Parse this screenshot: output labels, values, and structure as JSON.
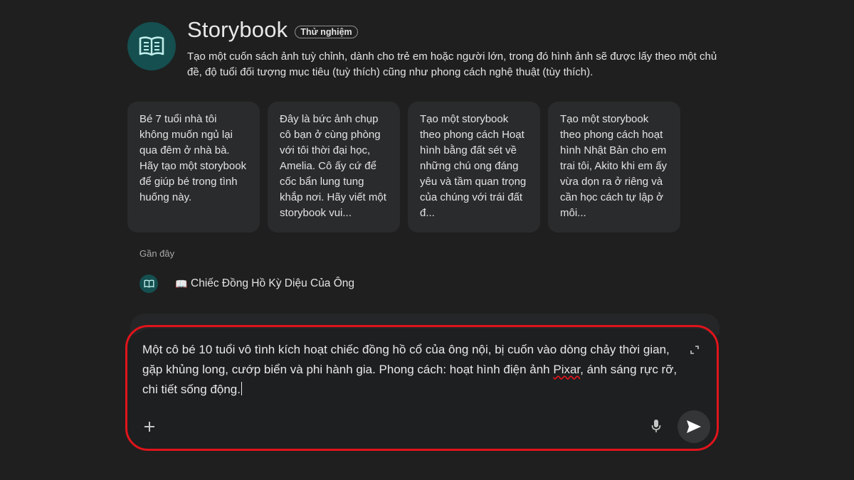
{
  "header": {
    "title": "Storybook",
    "badge": "Thử nghiệm",
    "description": "Tạo một cuốn sách ảnh tuỳ chỉnh, dành cho trẻ em hoặc người lớn, trong đó hình ảnh sẽ được lấy theo một chủ đề, độ tuổi đối tượng mục tiêu (tuỳ thích) cũng như phong cách nghệ thuật (tùy thích).",
    "icon": "book-icon"
  },
  "cards": [
    {
      "text": "Bé 7 tuổi nhà tôi không muốn ngủ lại qua đêm ở nhà bà. Hãy tạo một storybook để giúp bé trong tình huống này."
    },
    {
      "text": "Đây là bức ảnh chụp cô bạn ở cùng phòng với tôi thời đại học, Amelia. Cô ấy cứ để cốc bẩn lung tung khắp nơi. Hãy viết một storybook vui..."
    },
    {
      "text": "Tạo một storybook theo phong cách Hoạt hình bằng đất sét về những chú ong đáng yêu và tầm quan trọng của chúng với trái đất đ..."
    },
    {
      "text": "Tạo một storybook theo phong cách hoạt hình Nhật Bản cho em trai tôi, Akito khi em ấy vừa dọn ra ở riêng và cần học cách tự lập ở môi..."
    }
  ],
  "recent": {
    "label": "Gần đây",
    "items": [
      {
        "emoji": "📖",
        "title": "Chiếc Đồng Hồ Kỳ Diệu Của Ông"
      }
    ]
  },
  "input": {
    "text_before": "Một cô bé 10 tuổi vô tình kích hoạt chiếc đồng hồ cổ của ông nội, bị cuốn vào dòng chảy thời gian, gặp khủng long, cướp biển và phi hành gia. Phong cách: hoạt hình điện ảnh ",
    "misspelled_word": "Pixar",
    "text_after": ", ánh sáng rực rỡ, chi tiết sống động."
  },
  "colors": {
    "background": "#1f1f1f",
    "accent_teal": "#154f50",
    "highlight_red": "#e0141b"
  }
}
